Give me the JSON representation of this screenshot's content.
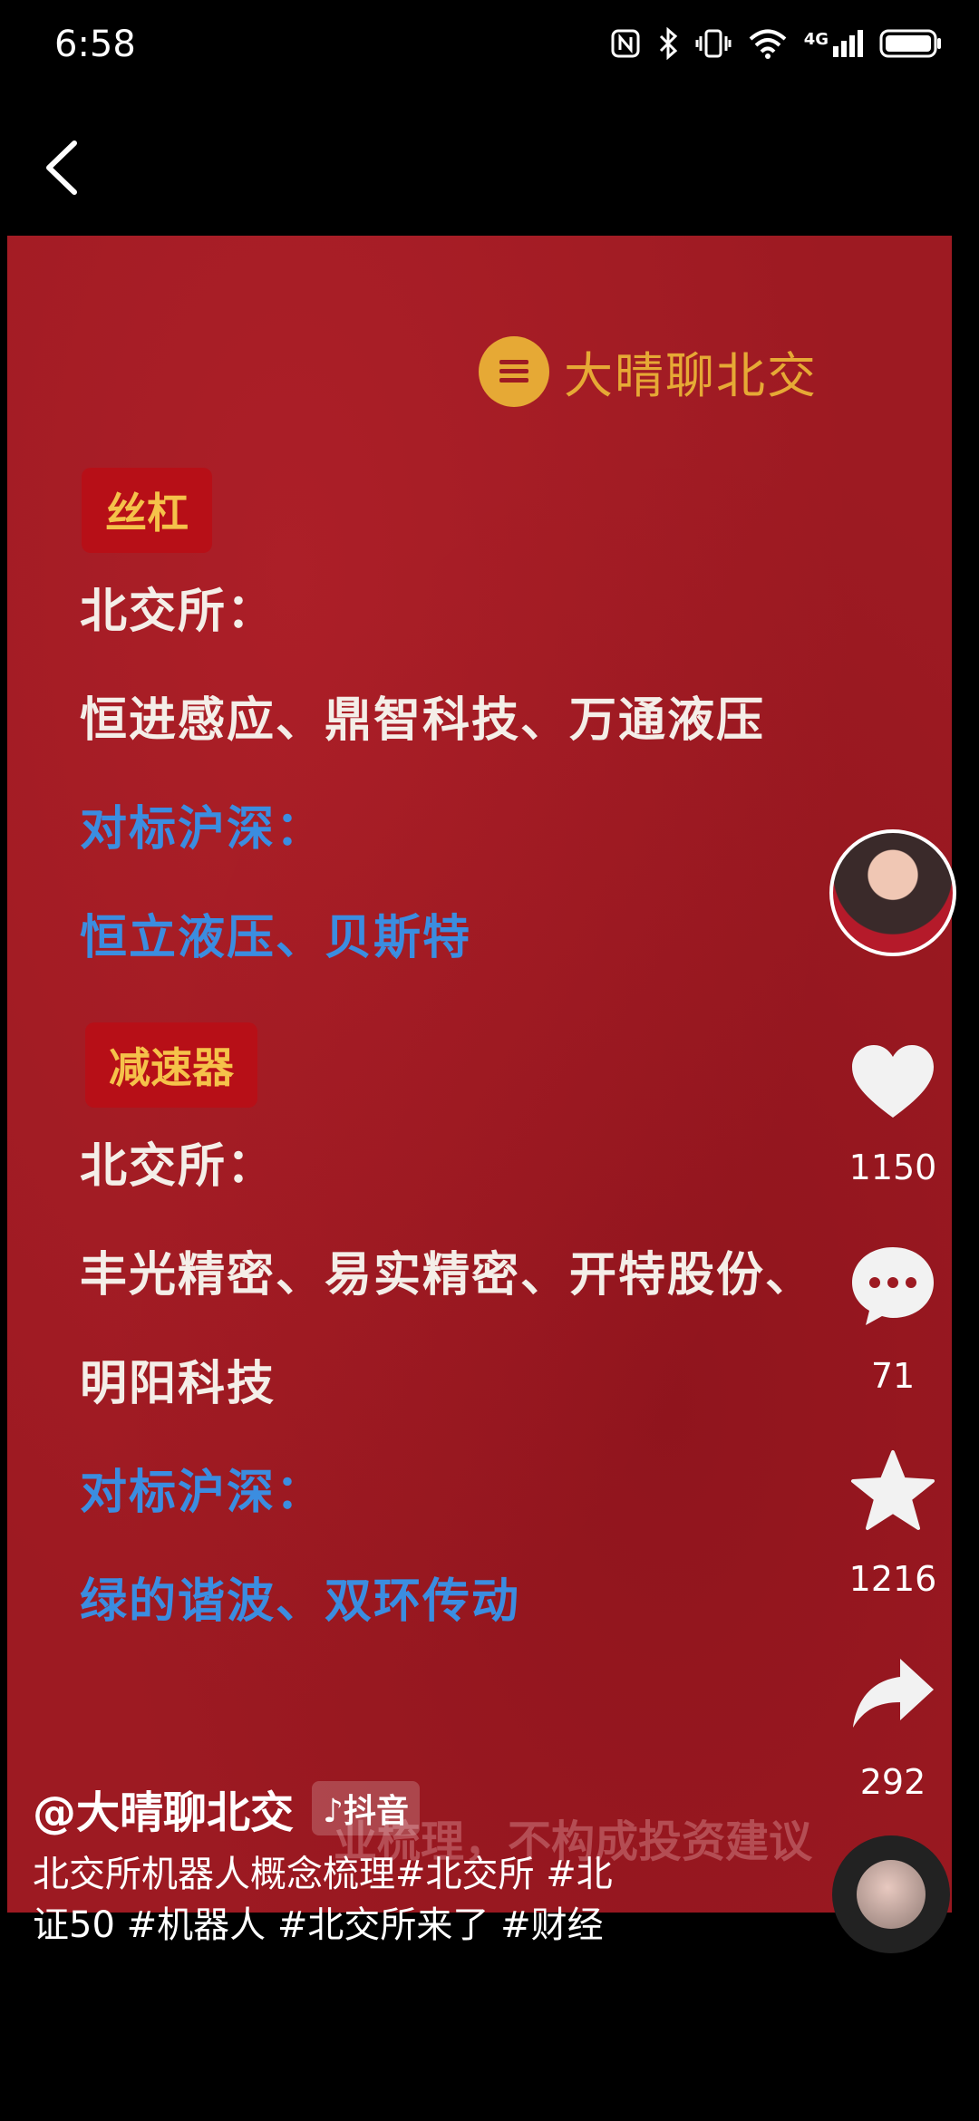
{
  "status_bar": {
    "time": "6:58",
    "icons": [
      "nfc-icon",
      "bluetooth-icon",
      "vibrate-icon",
      "wifi-icon",
      "signal-4g-icon",
      "battery-icon"
    ],
    "network": "4G"
  },
  "video": {
    "logo_text": "大晴聊北交",
    "sections": [
      {
        "tag": "丝杠",
        "lines": [
          {
            "text": "北交所：",
            "color": "white"
          },
          {
            "text": "恒进感应、鼎智科技、万通液压",
            "color": "white"
          },
          {
            "text": "对标沪深：",
            "color": "blue"
          },
          {
            "text": "恒立液压、贝斯特",
            "color": "blue"
          }
        ]
      },
      {
        "tag": "减速器",
        "lines": [
          {
            "text": "北交所：",
            "color": "white"
          },
          {
            "text": "丰光精密、易实精密、开特股份、",
            "color": "white"
          },
          {
            "text": "明阳科技",
            "color": "white"
          },
          {
            "text": "对标沪深：",
            "color": "blue"
          },
          {
            "text": "绿的谐波、双环传动",
            "color": "blue"
          }
        ]
      }
    ],
    "subtitle_overlay": "业梳理，不构成投资建议"
  },
  "actions": {
    "like_count": "1150",
    "comment_count": "71",
    "favorite_count": "1216",
    "share_count": "292"
  },
  "info": {
    "author": "@大晴聊北交",
    "badge": "抖音",
    "description_line1": "北交所机器人概念梳理#北交所 #北",
    "description_line2": "证50 #机器人 #北交所来了 #财经"
  }
}
